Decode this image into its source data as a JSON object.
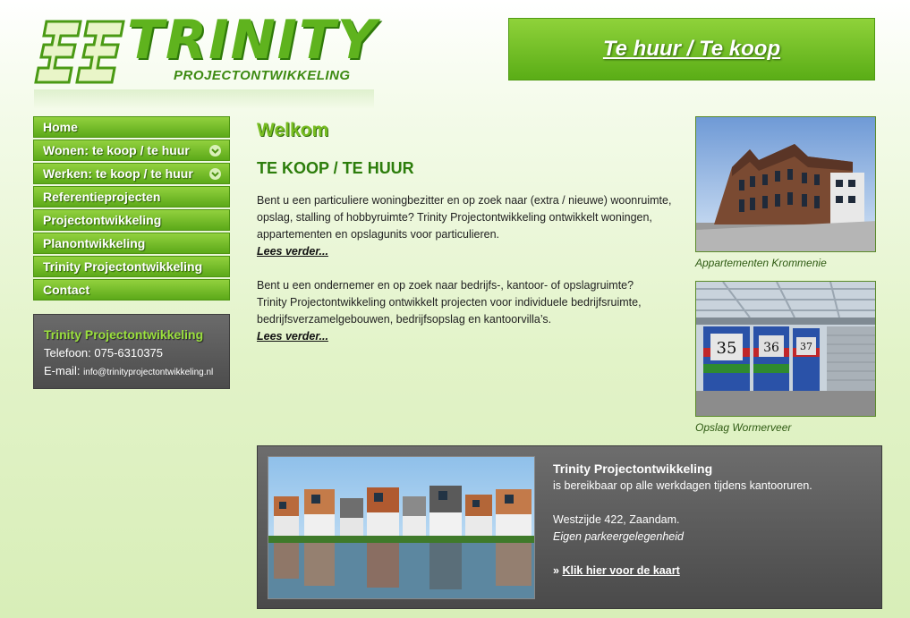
{
  "colors": {
    "brand_green": "#5fb31e",
    "dark_green": "#2c7d0b",
    "gray_box": "#5a5a5a"
  },
  "logo": {
    "mark": "33",
    "title": "TRINITY",
    "subtitle": "PROJECTONTWIKKELING"
  },
  "top_banner": {
    "label": "Te huur / Te koop"
  },
  "nav": {
    "items": [
      {
        "label": "Home",
        "has_submenu": false
      },
      {
        "label": "Wonen: te koop / te huur",
        "has_submenu": true
      },
      {
        "label": "Werken: te koop / te huur",
        "has_submenu": true
      },
      {
        "label": "Referentieprojecten",
        "has_submenu": false
      },
      {
        "label": "Projectontwikkeling",
        "has_submenu": false
      },
      {
        "label": "Planontwikkeling",
        "has_submenu": false
      },
      {
        "label": "Trinity Projectontwikkeling",
        "has_submenu": false
      },
      {
        "label": "Contact",
        "has_submenu": false
      }
    ]
  },
  "contact": {
    "title": "Trinity Projectontwikkeling",
    "phone": "Telefoon: 075-6310375",
    "email_label": "E-mail: ",
    "email": "info@trinityprojectontwikkeling.nl"
  },
  "main": {
    "welcome": "Welkom",
    "section_title": "TE KOOP / TE HUUR",
    "para1": [
      "Bent u een particuliere woningbezitter en op zoek naar (extra / nieuwe) woonruimte,",
      "opslag, stalling of hobbyruimte? Trinity Projectontwikkeling ontwikkelt woningen,",
      "appartementen en opslagunits voor particulieren."
    ],
    "more1": "Lees verder...",
    "para2": [
      "Bent u een ondernemer en op zoek naar bedrijfs-, kantoor- of opslagruimte?",
      "Trinity Projectontwikkeling ontwikkelt projecten voor individuele bedrijfsruimte,",
      "bedrijfsverzamelgebouwen, bedrijfsopslag en kantoorvilla’s."
    ],
    "more2": "Lees verder..."
  },
  "photos": [
    {
      "caption": "Appartementen Krommenie"
    },
    {
      "caption": "Opslag Wormerveer",
      "unit_numbers": [
        "35",
        "36",
        "37"
      ]
    }
  ],
  "bottom": {
    "title": "Trinity Projectontwikkeling",
    "line1": "is bereikbaar op alle werkdagen tijdens kantooruren.",
    "address": "Westzijde 422, Zaandam.",
    "parking": "Eigen parkeergelegenheid",
    "map_prefix": "» ",
    "map_link": "Klik hier voor de kaart"
  }
}
